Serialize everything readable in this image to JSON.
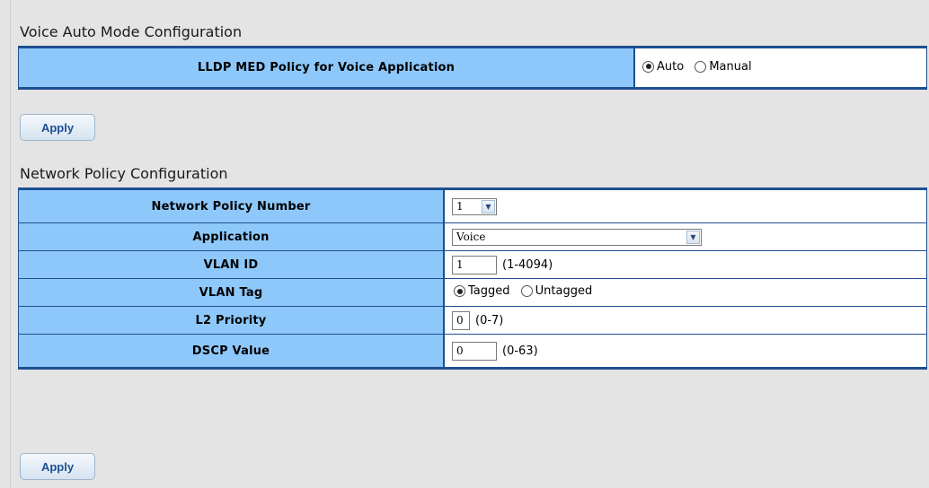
{
  "voice_auto": {
    "title": "Voice Auto Mode Configuration",
    "row_label": "LLDP MED Policy for Voice Application",
    "options": [
      {
        "label": "Auto",
        "checked": true
      },
      {
        "label": "Manual",
        "checked": false
      }
    ],
    "apply_label": "Apply"
  },
  "network_policy": {
    "title": "Network Policy Configuration",
    "number": {
      "label": "Network Policy Number",
      "value": "1"
    },
    "application": {
      "label": "Application",
      "value": "Voice"
    },
    "vlan_id": {
      "label": "VLAN ID",
      "value": "1",
      "range": "(1-4094)"
    },
    "vlan_tag": {
      "label": "VLAN Tag",
      "options": [
        {
          "label": "Tagged",
          "checked": true
        },
        {
          "label": "Untagged",
          "checked": false
        }
      ]
    },
    "l2_priority": {
      "label": "L2 Priority",
      "value": "0",
      "range": "(0-7)"
    },
    "dscp": {
      "label": "DSCP Value",
      "value": "0",
      "range": "(0-63)"
    },
    "apply_label": "Apply"
  },
  "colors": {
    "label_bg": "#8ec8fb",
    "border": "#1e4f91",
    "page_bg": "#e4e4e4"
  }
}
